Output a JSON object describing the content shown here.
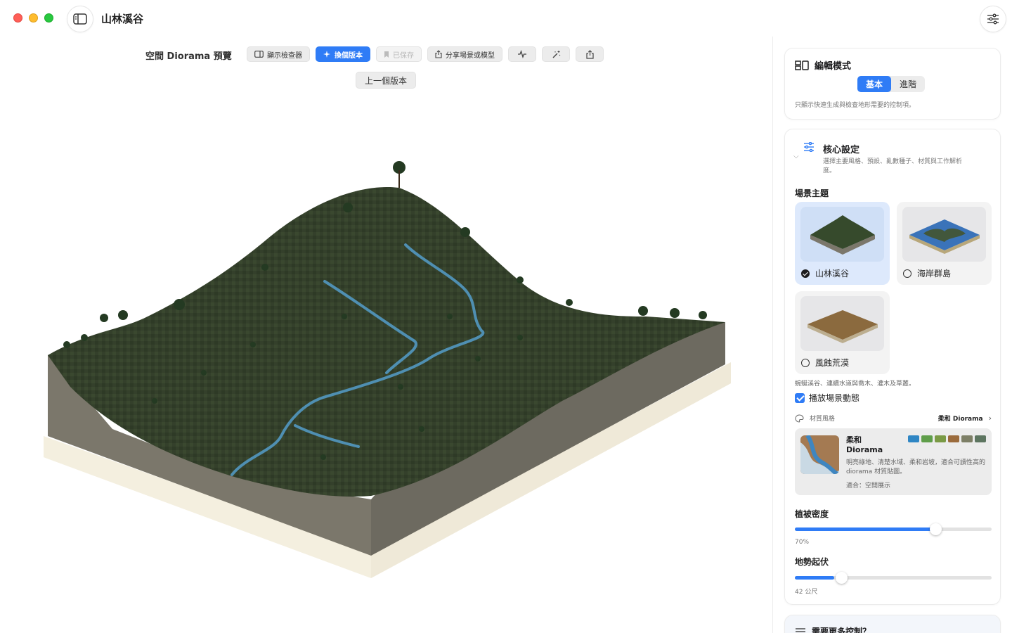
{
  "window": {
    "title": "山林溪谷"
  },
  "toolbar": {
    "preview_title": "空間 Diorama 預覽",
    "inspector": "顯示檢查器",
    "swap_version": "換個版本",
    "saved": "已保存",
    "share": "分享場景或模型",
    "prev_version": "上一個版本"
  },
  "edit_mode": {
    "title": "編輯模式",
    "options": [
      "基本",
      "進階"
    ],
    "selected": "基本",
    "description": "只顯示快速生成與檢查地形需要的控制項。"
  },
  "core": {
    "title": "核心設定",
    "description": "選擇主要風格、預設、亂數種子、材質與工作解析度。",
    "theme_label": "場景主題",
    "themes": [
      {
        "label": "山林溪谷",
        "selected": true
      },
      {
        "label": "海岸群島",
        "selected": false
      },
      {
        "label": "風蝕荒漠",
        "selected": false
      }
    ],
    "theme_description": "蜿蜒溪谷、連續水道與喬木、灌木及草叢。",
    "animate_label": "播放場景動態",
    "animate_checked": true,
    "material_label": "材質風格",
    "material_value": "柔和 Diorama",
    "material_card": {
      "name": "柔和 Diorama",
      "description": "明亮綠地、清楚水域、柔和岩坡，適合可讀性高的 diorama 材質貼圖。",
      "fit": "適合：空間展示",
      "swatches": [
        "#2f86c4",
        "#5f9e4a",
        "#7a9a45",
        "#9b6b3c",
        "#7d7f66",
        "#5d7560"
      ]
    },
    "vegetation": {
      "label": "植被密度",
      "value_text": "70%",
      "value": 0.7
    },
    "relief": {
      "label": "地勢起伏",
      "value_text": "42 公尺",
      "value": 0.2
    }
  },
  "more": {
    "title": "需要更多控制？"
  }
}
